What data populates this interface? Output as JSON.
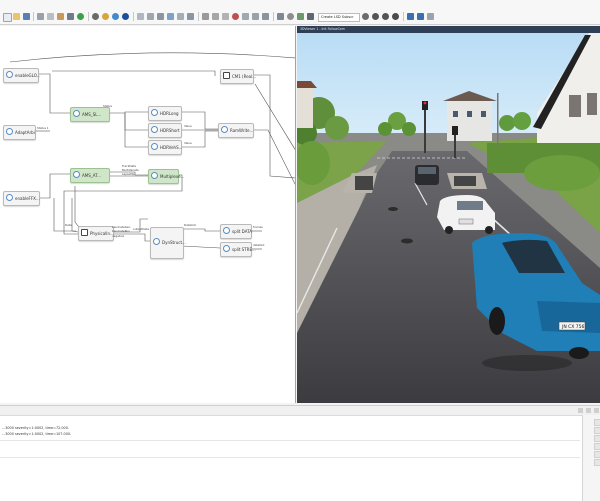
{
  "toolbar": {
    "search_value": "Create LSD Subscr",
    "accent": "#3a6fb0"
  },
  "diagram": {
    "blocks": [
      {
        "key": "enable_left",
        "label": "enableGLO...",
        "green": false
      },
      {
        "key": "adapt",
        "label": "AdaptArbi",
        "green": false
      },
      {
        "key": "enable_ffx",
        "label": "enableFFX...",
        "green": false
      },
      {
        "key": "ams_sl",
        "label": "AMS_SL...",
        "green": true
      },
      {
        "key": "ams_at",
        "label": "AMS_AT...",
        "green": true
      },
      {
        "key": "hdr_long",
        "label": "HDRLong",
        "green": false
      },
      {
        "key": "hdr_short",
        "label": "HDRShort",
        "green": false
      },
      {
        "key": "hdr_veh",
        "label": "HDRVehS...",
        "green": false
      },
      {
        "key": "multiplexer",
        "label": "Multiplexe...",
        "green": true
      },
      {
        "key": "cm_real",
        "label": "CM1 (Real...",
        "green": false
      },
      {
        "key": "ramwrite",
        "label": "RamWrite...",
        "green": false
      },
      {
        "key": "physical",
        "label": "PhysicalIn...",
        "green": false
      },
      {
        "key": "dynstruct",
        "label": "DynStruct...",
        "green": false
      },
      {
        "key": "split_data",
        "label": "split DATA",
        "green": false
      },
      {
        "key": "split_stre",
        "label": "split STRE...",
        "green": false
      }
    ],
    "ports": {
      "status1": "Status 1",
      "status": "Status",
      "value": "Value",
      "val2": "Value",
      "trackedata": "TrackData",
      "multivariate": "MultiVariate",
      "lapsemp": "LapseMp",
      "baudrateGen": "baudrateGen",
      "baudrateRun": "baudrateRun",
      "data": "Data",
      "outputdata": "outputData",
      "negative": "negative",
      "dyn_out": "DataOut",
      "frames": "frames",
      "data_out": "dataOut"
    }
  },
  "viewport": {
    "title": "3DViewer 1 - Init FollowCam",
    "plate": "JN CX 756"
  },
  "console": {
    "lines": [
      "...3000 severity=1:0002, time=72.000.",
      "...3000 severity=1:0002, time=107.000."
    ]
  }
}
